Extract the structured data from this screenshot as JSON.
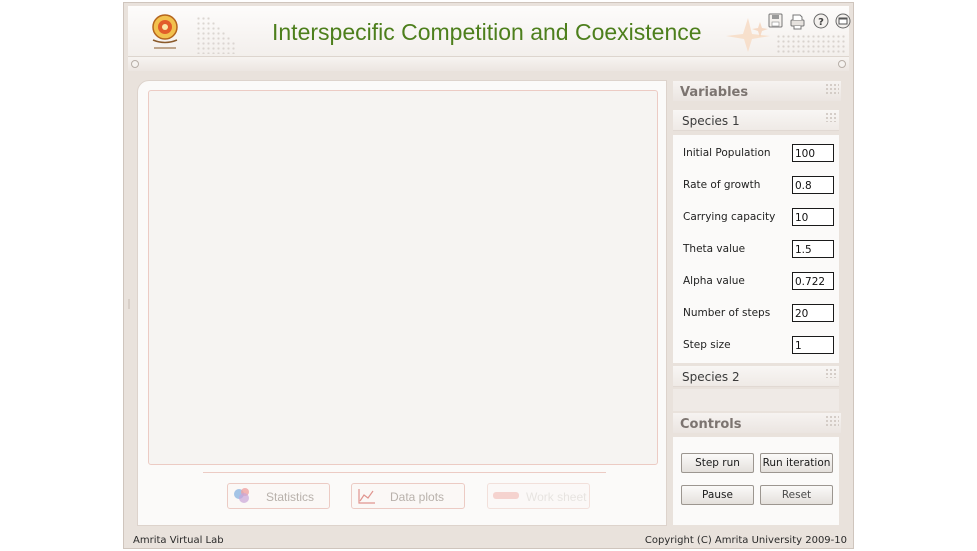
{
  "header": {
    "title": "Interspecific Competition and Coexistence",
    "icons": [
      "save-icon",
      "print-icon",
      "help-icon",
      "window-icon"
    ]
  },
  "plot_area": {
    "buttons": [
      {
        "label": "Statistics",
        "icon": "statistics-icon"
      },
      {
        "label": "Data plots",
        "icon": "data-plots-icon"
      },
      {
        "label": "Work sheet",
        "icon": "work-sheet-icon"
      }
    ]
  },
  "variables": {
    "title": "Variables",
    "species1": {
      "title": "Species 1",
      "fields": [
        {
          "label": "Initial Population",
          "value": "100"
        },
        {
          "label": "Rate of growth",
          "value": "0.8"
        },
        {
          "label": "Carrying capacity",
          "value": "10"
        },
        {
          "label": "Theta value",
          "value": "1.5"
        },
        {
          "label": "Alpha value",
          "value": "0.722"
        },
        {
          "label": "Number of steps",
          "value": "20"
        },
        {
          "label": "Step size",
          "value": "1"
        }
      ]
    },
    "species2": {
      "title": "Species 2"
    }
  },
  "controls": {
    "title": "Controls",
    "step_run": "Step run",
    "run_iteration": "Run iteration",
    "pause": "Pause",
    "reset": "Reset"
  },
  "footer": {
    "left": "Amrita Virtual Lab",
    "right": "Copyright (C) Amrita University 2009-10"
  },
  "colors": {
    "title_green": "#4d7f1c",
    "frame": "#e9e2dc",
    "accent_border": "#eccbc4"
  }
}
